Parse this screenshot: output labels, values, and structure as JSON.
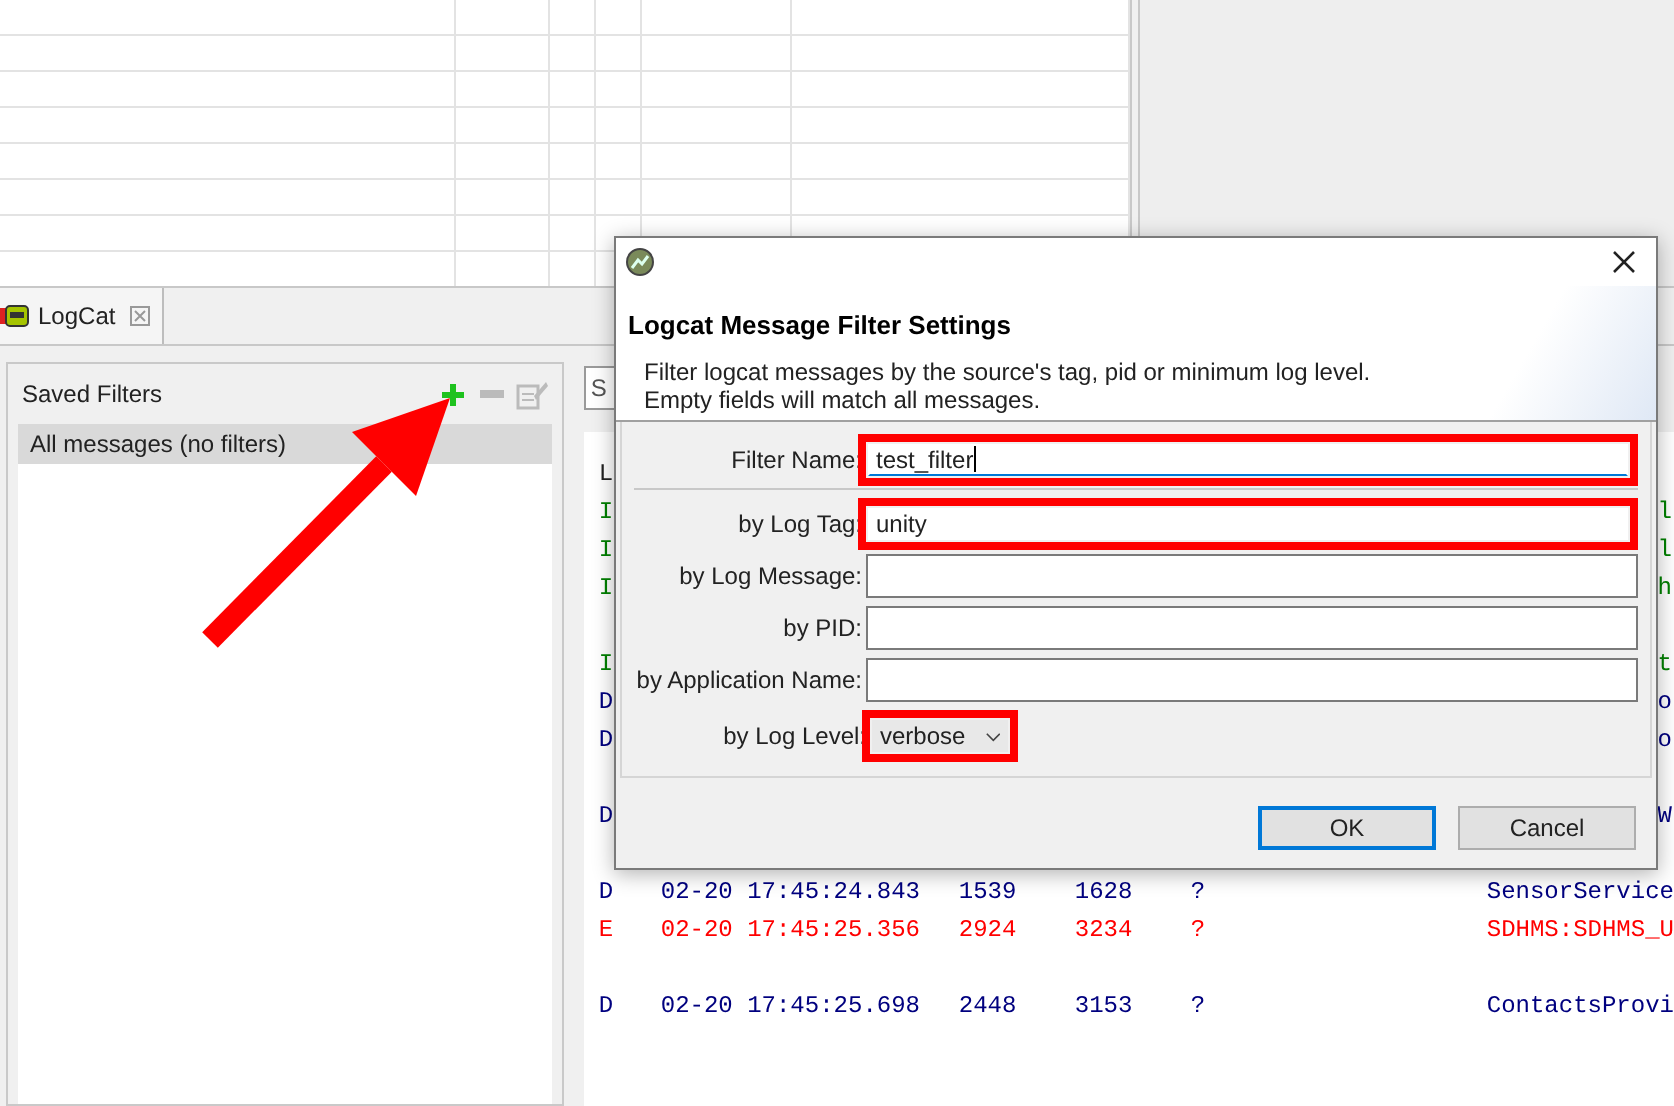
{
  "logcat_tab": {
    "label": "LogCat"
  },
  "saved_filters": {
    "title": "Saved Filters",
    "items": [
      {
        "label": "All messages (no filters)",
        "selected": true
      }
    ]
  },
  "log_view": {
    "search": {
      "placeholder": "S"
    },
    "header": "L",
    "rows": [
      {
        "kind": "hidden",
        "level": "I",
        "tail": "l",
        "color": "#008000"
      },
      {
        "kind": "hidden",
        "level": "I",
        "tail": "l",
        "color": "#008000"
      },
      {
        "kind": "hidden",
        "level": "I",
        "tail": "h",
        "color": "#008000"
      },
      {
        "kind": "empty"
      },
      {
        "kind": "hidden",
        "level": "I",
        "tail": "t",
        "color": "#008000"
      },
      {
        "kind": "hidden",
        "level": "D",
        "tail": "o",
        "color": "#00007f"
      },
      {
        "kind": "hidden",
        "level": "D",
        "tail": "o",
        "color": "#00007f"
      },
      {
        "kind": "empty"
      },
      {
        "kind": "hidden",
        "level": "D",
        "tail": "W",
        "color": "#00007f"
      },
      {
        "kind": "empty"
      },
      {
        "kind": "full",
        "level": "D",
        "time": "02-20 17:45:24.843",
        "pid": "1539",
        "tid": "1628",
        "app": "?",
        "tag": "SensorService",
        "color": "#00007f"
      },
      {
        "kind": "full",
        "level": "E",
        "time": "02-20 17:45:25.356",
        "pid": "2924",
        "tid": "3234",
        "app": "?",
        "tag": "SDHMS:SDHMS_U",
        "color": "#ff0000"
      },
      {
        "kind": "empty"
      },
      {
        "kind": "full",
        "level": "D",
        "time": "02-20 17:45:25.698",
        "pid": "2448",
        "tid": "3153",
        "app": "?",
        "tag": "ContactsProvi",
        "color": "#00007f"
      }
    ]
  },
  "dialog": {
    "heading": "Logcat Message Filter Settings",
    "description": [
      "Filter logcat messages by the source's tag, pid or minimum log level.",
      "Empty fields will match all messages."
    ],
    "fields": [
      {
        "label": "Filter Name:",
        "value": "test_filter",
        "highlighted": true,
        "focused": true
      },
      {
        "label": "by Log Tag:",
        "value": "unity",
        "highlighted": true,
        "focused": false
      },
      {
        "label": "by Log Message:",
        "highlighted": false,
        "focused": false
      },
      {
        "label": "by PID:",
        "highlighted": false,
        "focused": false
      },
      {
        "label": "by Application Name:",
        "highlighted": false,
        "focused": false
      }
    ],
    "log_level": {
      "label": "by Log Level:",
      "value": "verbose",
      "highlighted": true
    },
    "buttons": [
      {
        "label": "OK",
        "default": true
      },
      {
        "label": "Cancel",
        "default": false
      }
    ]
  }
}
